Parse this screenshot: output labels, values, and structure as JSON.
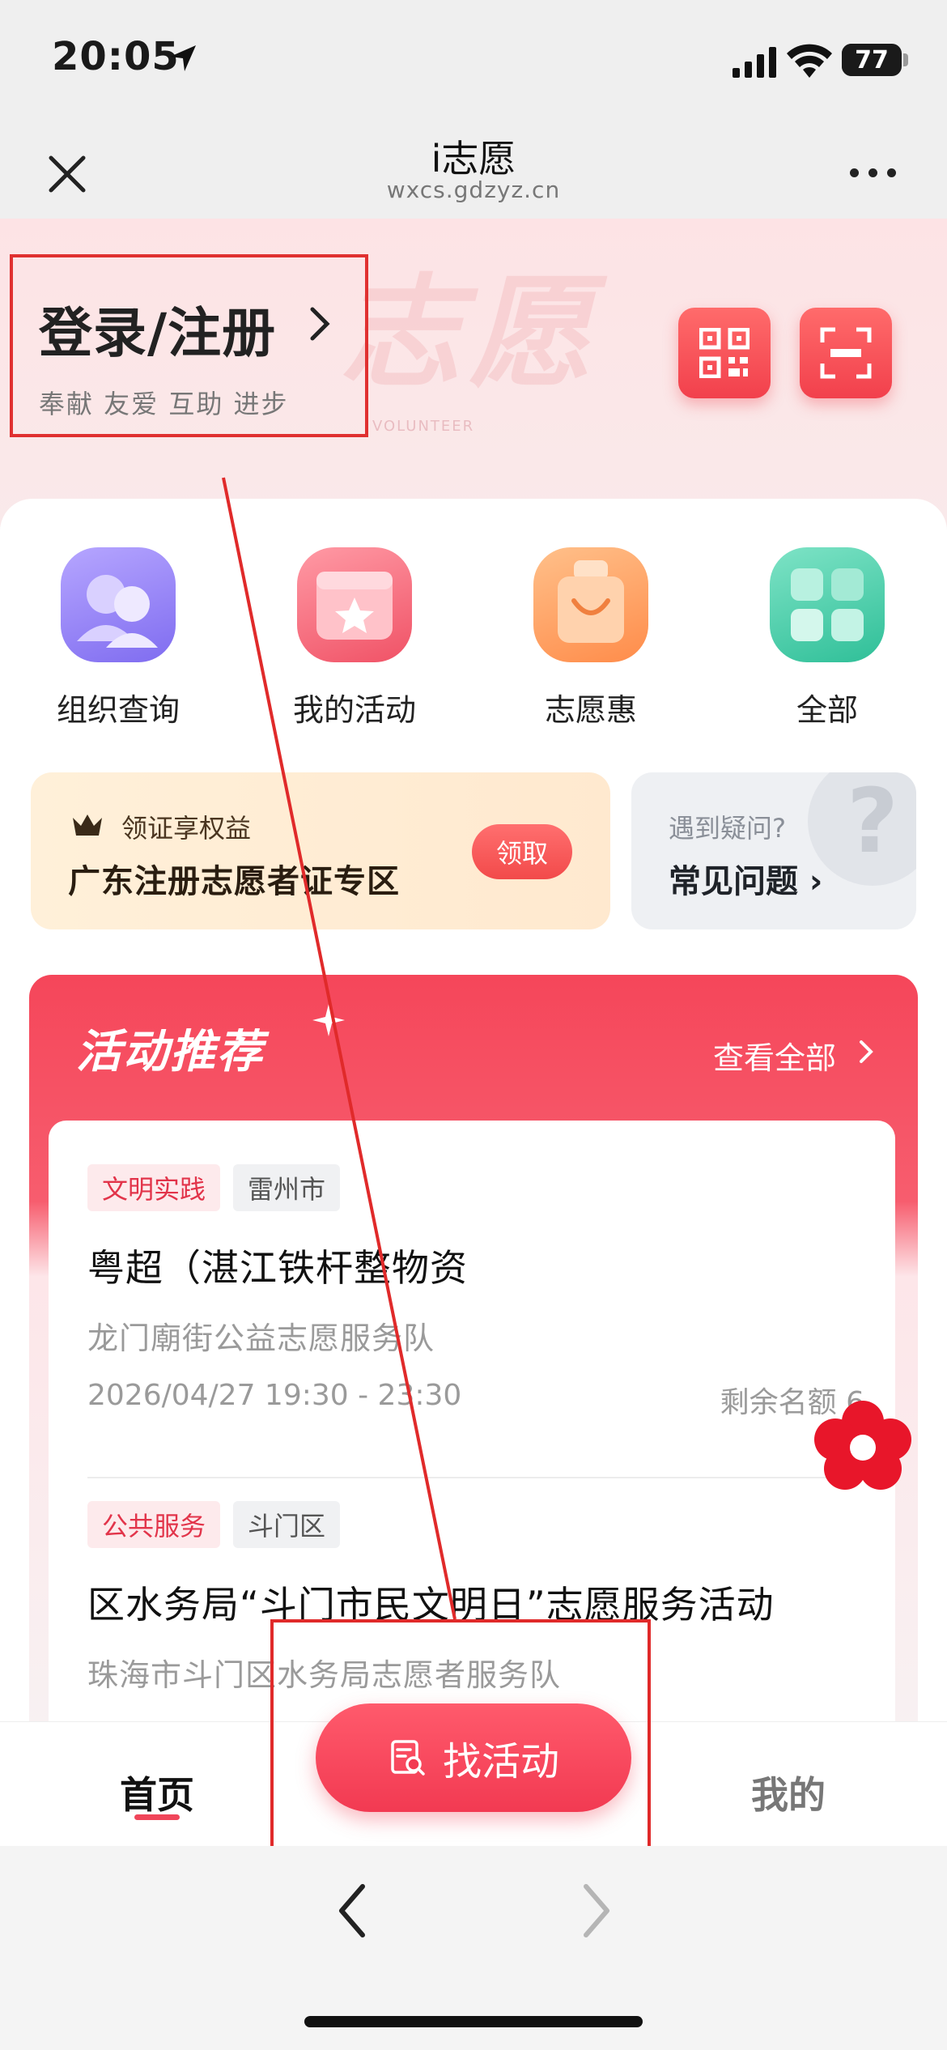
{
  "status_bar": {
    "time": "20:05",
    "battery": "77",
    "battery_level_pct": 77
  },
  "nav": {
    "title": "i志愿",
    "url": "wxcs.gdzyz.cn"
  },
  "hero": {
    "login_label": "登录/注册",
    "slogan": "奉献 友爱 互助 进步",
    "watermark": "志愿",
    "watermark_sub": "VOLUNTEER"
  },
  "quick_links": [
    {
      "label": "组织查询",
      "icon": "org-query-icon"
    },
    {
      "label": "我的活动",
      "icon": "my-activity-icon"
    },
    {
      "label": "志愿惠",
      "icon": "shopping-bag-icon"
    },
    {
      "label": "全部",
      "icon": "all-grid-icon"
    }
  ],
  "cert_banner": {
    "subtitle": "领证享权益",
    "title": "广东注册志愿者证专区",
    "button": "领取"
  },
  "faq_banner": {
    "subtitle": "遇到疑问?",
    "title": "常见问题 ›"
  },
  "recommend": {
    "title": "活动推荐",
    "view_all": "查看全部",
    "activities": [
      {
        "tags": [
          "文明实践",
          "雷州市"
        ],
        "title": "粤超（湛江铁杆整物资",
        "org": "龙门廟街公益志愿服务队",
        "time": "2026/04/27 19:30 - 23:30",
        "quota": "剩余名额 6"
      },
      {
        "tags": [
          "公共服务",
          "斗门区"
        ],
        "title": "区水务局“斗门市民文明日”志愿服务活动",
        "org": "珠海市斗门区水务局志愿者服务队"
      }
    ]
  },
  "tab_bar": {
    "home": "首页",
    "find": "找活动",
    "mine": "我的"
  },
  "colors": {
    "accent": "#f0455a",
    "annotation": "#e02a2a"
  }
}
